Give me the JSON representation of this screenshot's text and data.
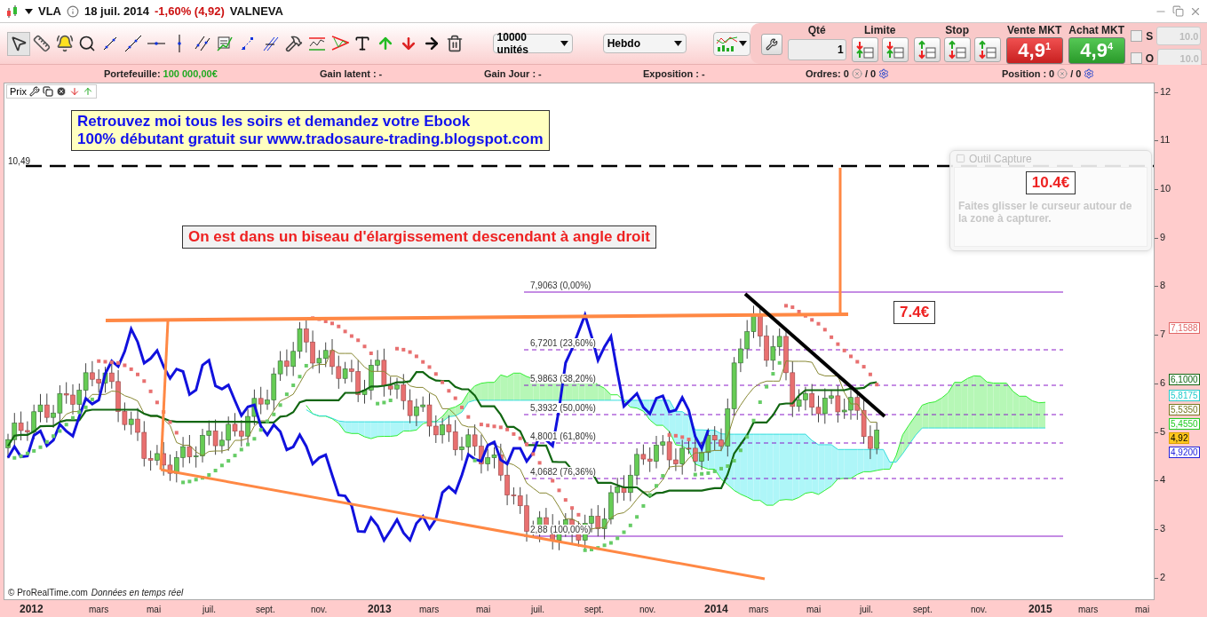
{
  "header": {
    "symbol": "VLA",
    "date": "18 juil. 2014",
    "change": "-1,60% (4,92)",
    "name": "VALNEVA"
  },
  "toolbar": {
    "tools": [
      {
        "kind": "pointer",
        "selected": true
      },
      {
        "kind": "ruler",
        "selected": false
      },
      {
        "kind": "bell",
        "selected": false
      },
      {
        "kind": "zoom",
        "selected": false
      },
      {
        "kind": "segment",
        "selected": false
      },
      {
        "kind": "ray",
        "selected": false
      },
      {
        "kind": "horizontal",
        "selected": false
      },
      {
        "kind": "vertical",
        "selected": false
      },
      {
        "kind": "parallel",
        "selected": false
      },
      {
        "kind": "fibonacci",
        "selected": false
      },
      {
        "kind": "dotted",
        "selected": false
      },
      {
        "kind": "channel",
        "selected": false
      },
      {
        "kind": "tools",
        "selected": false
      },
      {
        "kind": "zone",
        "selected": false
      },
      {
        "kind": "triangle",
        "selected": false
      },
      {
        "kind": "text",
        "selected": false
      },
      {
        "kind": "up",
        "selected": false
      },
      {
        "kind": "down",
        "selected": false
      },
      {
        "kind": "right",
        "selected": false
      },
      {
        "kind": "trash",
        "selected": false
      }
    ],
    "quantity_select": "10000 unités",
    "period_select": "Hebdo"
  },
  "order_panel": {
    "qty_label": "Qté",
    "qty": "1",
    "limit_label": "Limite",
    "stop_label": "Stop",
    "sell_label": "Vente MKT",
    "sell_price": "4,9$^{1}$",
    "buy_label": "Achat MKT",
    "buy_price": "4,9$^{4}$",
    "options": [
      {
        "label": "S",
        "checked": false,
        "value": "10.0",
        "disabled": true
      },
      {
        "label": "O",
        "checked": false,
        "value": "10.0",
        "disabled": true
      }
    ]
  },
  "account_bar": [
    {
      "kind": "value",
      "label": "Portefeuille:",
      "value": "100 000,00€",
      "color": "#22aa22"
    },
    {
      "kind": "value",
      "label": "Gain latent :",
      "value": "-"
    },
    {
      "kind": "value",
      "label": "Gain Jour :",
      "value": "-"
    },
    {
      "kind": "value",
      "label": "Exposition :",
      "value": "-"
    },
    {
      "kind": "counter",
      "label": "Ordres:",
      "count": "0",
      "total": "/ 0"
    },
    {
      "kind": "counter",
      "label": "Position :",
      "count": "0",
      "total": "/ 0"
    }
  ],
  "chart": {
    "panel_label": "Prix",
    "level_line_label": "10,49",
    "fib_levels": [
      {
        "label": "7,9063 (0,00%)",
        "kind": "solid"
      },
      {
        "label": "6,7201 (23,60%)",
        "kind": "dashed"
      },
      {
        "label": "5,9863 (38,20%)",
        "kind": "dashed"
      },
      {
        "label": "5,3932 (50,00%)",
        "kind": "dashed"
      },
      {
        "label": "4,8001 (61,80%)",
        "kind": "dashed"
      },
      {
        "label": "4,0682 (76,36%)",
        "kind": "dashed"
      },
      {
        "label": "2,88 (100,00%)",
        "kind": "solid"
      }
    ],
    "notes": [
      {
        "kind": "info",
        "text": "Retrouvez moi tous les soirs et demandez votre Ebook\n100% débutant gratuit sur www.tradosaure-trading.blogspot.com"
      },
      {
        "kind": "alert",
        "text": "On est dans un biseau d'élargissement descendant à angle droit"
      },
      {
        "kind": "price",
        "text": "7.4€"
      }
    ],
    "capture_window": {
      "title": "Outil Capture",
      "price_note": "10.4€",
      "hint": "Faites glisser le curseur autour de la zone à capturer."
    },
    "y_ticks": [
      "12",
      "11",
      "10",
      "9",
      "8",
      "7",
      "6",
      "5",
      "4",
      "3",
      "2"
    ],
    "price_badges": [
      {
        "text": "7,1588",
        "kind": "plain",
        "color": "#e06666"
      },
      {
        "text": "6,1000",
        "kind": "plain",
        "color": "#116611"
      },
      {
        "text": "5,8175",
        "kind": "plain",
        "color": "#22cccc"
      },
      {
        "text": "5,5350",
        "kind": "plain",
        "color": "#777722"
      },
      {
        "text": "5,4550",
        "kind": "plain",
        "color": "#22cc22"
      },
      {
        "text": "4,92",
        "kind": "last"
      },
      {
        "text": "4,9200",
        "kind": "plain",
        "color": "#2222dd"
      }
    ],
    "x_ticks": [
      {
        "label": "2012",
        "kind": "year"
      },
      {
        "label": "mars",
        "kind": "month"
      },
      {
        "label": "mai",
        "kind": "month"
      },
      {
        "label": "juil.",
        "kind": "month"
      },
      {
        "label": "sept.",
        "kind": "month"
      },
      {
        "label": "nov.",
        "kind": "month"
      },
      {
        "label": "2013",
        "kind": "year"
      },
      {
        "label": "mars",
        "kind": "month"
      },
      {
        "label": "mai",
        "kind": "month"
      },
      {
        "label": "juil.",
        "kind": "month"
      },
      {
        "label": "sept.",
        "kind": "month"
      },
      {
        "label": "nov.",
        "kind": "month"
      },
      {
        "label": "2014",
        "kind": "year"
      },
      {
        "label": "mars",
        "kind": "month"
      },
      {
        "label": "mai",
        "kind": "month"
      },
      {
        "label": "juil.",
        "kind": "month"
      },
      {
        "label": "sept.",
        "kind": "month"
      },
      {
        "label": "nov.",
        "kind": "month"
      },
      {
        "label": "2015",
        "kind": "year"
      },
      {
        "label": "mars",
        "kind": "month"
      },
      {
        "label": "mai",
        "kind": "month"
      }
    ],
    "footer": {
      "source": "© ProRealTime.com",
      "feed": "Données en temps réel"
    }
  }
}
